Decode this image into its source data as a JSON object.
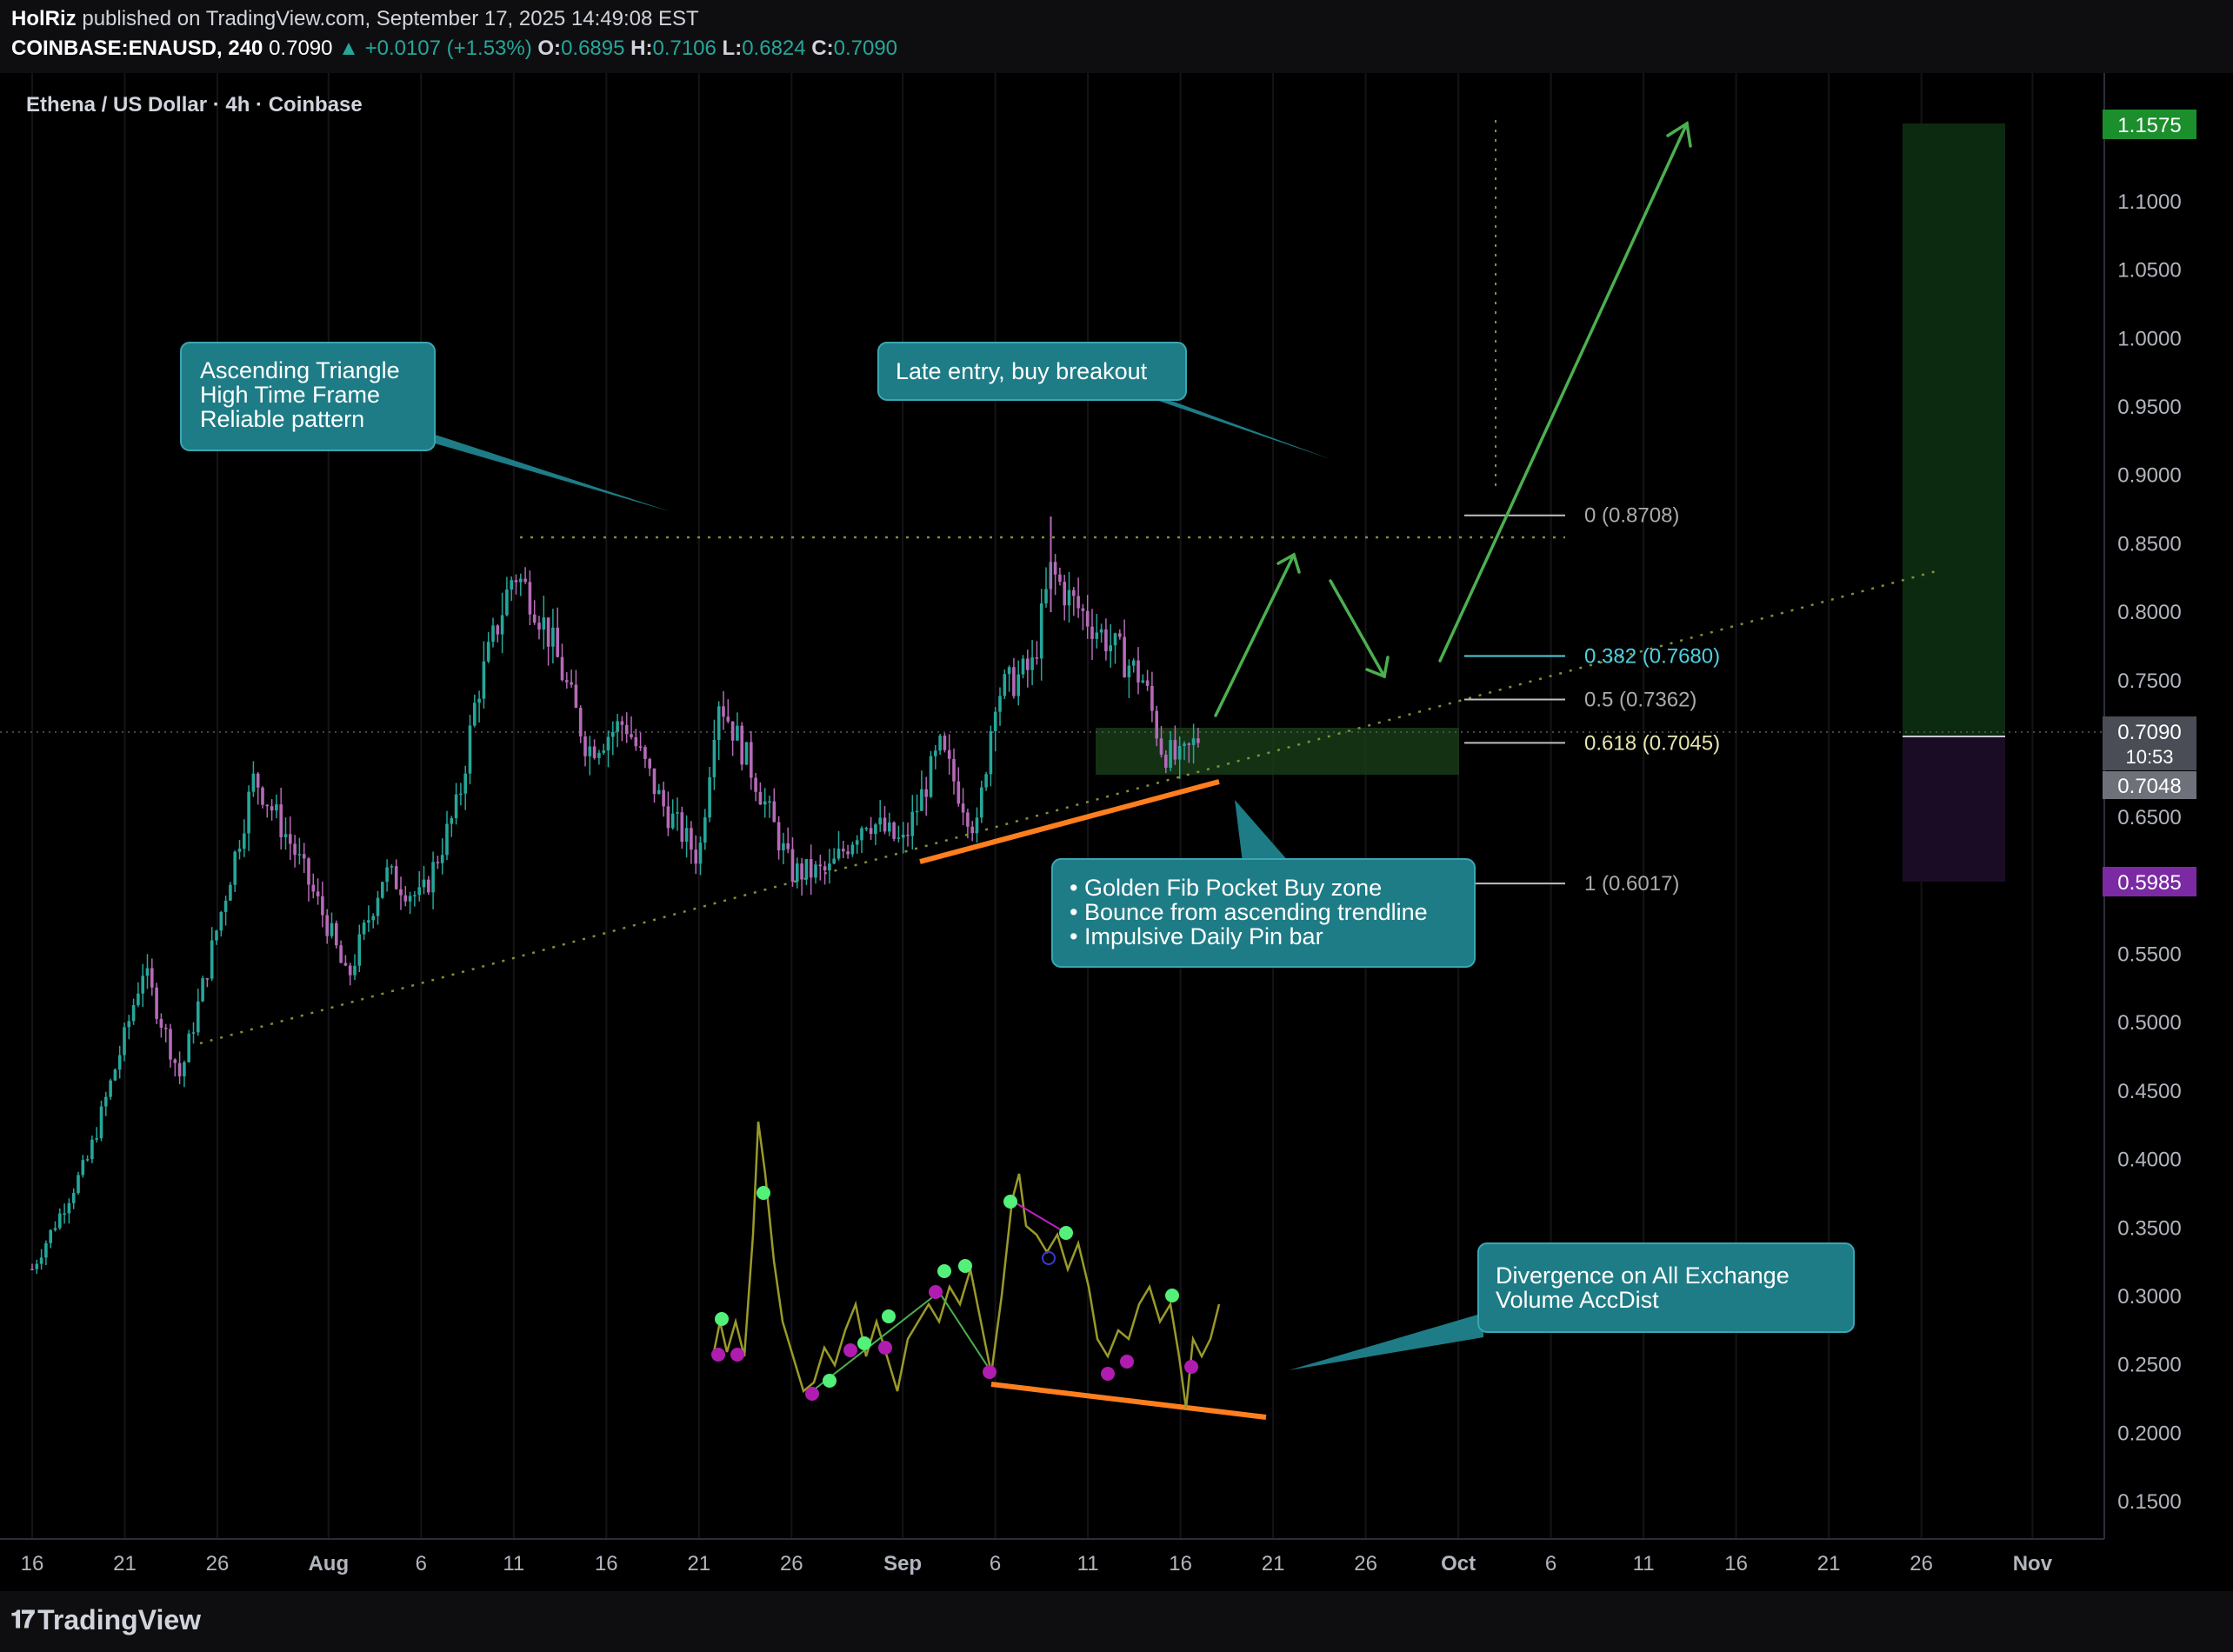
{
  "header": {
    "publisher": "HolRiz",
    "published_text": "published on TradingView.com, September 17, 2025 14:49:08 EST",
    "symbol": "COINBASE:ENAUSD, 240",
    "price": "0.7090",
    "change": "▲ +0.0107 (+1.53%)",
    "o_label": "O:",
    "o_value": "0.6895",
    "h_label": "H:",
    "h_value": "0.7106",
    "l_label": "L:",
    "l_value": "0.6824",
    "c_label": "C:",
    "c_value": "0.7090"
  },
  "chart_title": "Ethena / US Dollar · 4h · Coinbase",
  "footer": {
    "brand": "TradingView"
  },
  "colors": {
    "background": "#000000",
    "up": "#26a69a",
    "down": "#b56ab7",
    "callout": "#1e7c86",
    "orange": "#ff7f1e",
    "green_arrow": "#4caf50",
    "fib_cyan": "#4dd0e1",
    "profit_zone": "#0d3311",
    "loss_zone": "#1e0e2b"
  },
  "chart_data": {
    "type": "candlestick",
    "symbol": "ENAUSD",
    "interval": "4h",
    "y_range": [
      0.115,
      1.19
    ],
    "y_ticks": [
      "0.1500",
      "0.2000",
      "0.2500",
      "0.3000",
      "0.3500",
      "0.4000",
      "0.4500",
      "0.5000",
      "0.5500",
      "0.6000",
      "0.6500",
      "0.7000",
      "0.7500",
      "0.8000",
      "0.8500",
      "0.9000",
      "0.9500",
      "1.0000",
      "1.0500",
      "1.1000"
    ],
    "x_ticks": [
      "16",
      "21",
      "26",
      "Aug",
      "6",
      "11",
      "16",
      "21",
      "26",
      "Sep",
      "6",
      "11",
      "16",
      "21",
      "26",
      "Oct",
      "6",
      "11",
      "16",
      "21",
      "26",
      "Nov"
    ],
    "price_labels": {
      "target": "1.1575",
      "last": "0.7090",
      "countdown": "10:53",
      "entry": "0.7048",
      "stop": "0.5985"
    },
    "price_path_anchors": [
      {
        "date": "Jul 16",
        "price": 0.32
      },
      {
        "date": "Jul 19",
        "price": 0.4
      },
      {
        "date": "Jul 21",
        "price": 0.49
      },
      {
        "date": "Jul 22",
        "price": 0.54
      },
      {
        "date": "Jul 24",
        "price": 0.46
      },
      {
        "date": "Jul 26",
        "price": 0.57
      },
      {
        "date": "Jul 28",
        "price": 0.68
      },
      {
        "date": "Jul 30",
        "price": 0.63
      },
      {
        "date": "Aug 1",
        "price": 0.57
      },
      {
        "date": "Aug 2",
        "price": 0.53
      },
      {
        "date": "Aug 4",
        "price": 0.61
      },
      {
        "date": "Aug 6",
        "price": 0.59
      },
      {
        "date": "Aug 8",
        "price": 0.66
      },
      {
        "date": "Aug 9",
        "price": 0.74
      },
      {
        "date": "Aug 11",
        "price": 0.83
      },
      {
        "date": "Aug 12",
        "price": 0.81
      },
      {
        "date": "Aug 13",
        "price": 0.78
      },
      {
        "date": "Aug 15",
        "price": 0.7
      },
      {
        "date": "Aug 17",
        "price": 0.72
      },
      {
        "date": "Aug 19",
        "price": 0.66
      },
      {
        "date": "Aug 21",
        "price": 0.62
      },
      {
        "date": "Aug 22",
        "price": 0.74
      },
      {
        "date": "Aug 24",
        "price": 0.68
      },
      {
        "date": "Aug 26",
        "price": 0.61
      },
      {
        "date": "Aug 28",
        "price": 0.61
      },
      {
        "date": "Aug 30",
        "price": 0.65
      },
      {
        "date": "Sep 1",
        "price": 0.63
      },
      {
        "date": "Sep 3",
        "price": 0.7
      },
      {
        "date": "Sep 5",
        "price": 0.64
      },
      {
        "date": "Sep 6",
        "price": 0.74
      },
      {
        "date": "Sep 8",
        "price": 0.76
      },
      {
        "date": "Sep 9",
        "price": 0.83
      },
      {
        "date": "Sep 10",
        "price": 0.81
      },
      {
        "date": "Sep 12",
        "price": 0.78
      },
      {
        "date": "Sep 14",
        "price": 0.75
      },
      {
        "date": "Sep 15",
        "price": 0.7
      },
      {
        "date": "Sep 16",
        "price": 0.69
      },
      {
        "date": "Sep 17",
        "price": 0.709
      }
    ],
    "ohlc_last": {
      "open": 0.6895,
      "high": 0.7106,
      "low": 0.6824,
      "close": 0.709
    },
    "fibonacci": [
      {
        "level": "0",
        "value": 0.8708,
        "label": "0 (0.8708)"
      },
      {
        "level": "0.382",
        "value": 0.768,
        "label": "0.382 (0.7680)"
      },
      {
        "level": "0.5",
        "value": 0.7362,
        "label": "0.5 (0.7362)"
      },
      {
        "level": "0.618",
        "value": 0.7045,
        "label": "0.618 (0.7045)"
      },
      {
        "level": "1",
        "value": 0.6017,
        "label": "1 (0.6017)"
      }
    ],
    "resistance_level": 0.855,
    "position": {
      "entry": 0.7048,
      "target": 1.1575,
      "stop": 0.5985
    }
  },
  "annotations": {
    "triangle": [
      "Ascending Triangle",
      "High Time Frame",
      "Reliable pattern"
    ],
    "late_entry": [
      "Late entry, buy breakout"
    ],
    "fib_zone": [
      "• Golden Fib Pocket Buy zone",
      "• Bounce from ascending trendline",
      "• Impulsive Daily Pin bar"
    ],
    "divergence": [
      "Divergence on All Exchange",
      "Volume AccDist"
    ]
  }
}
